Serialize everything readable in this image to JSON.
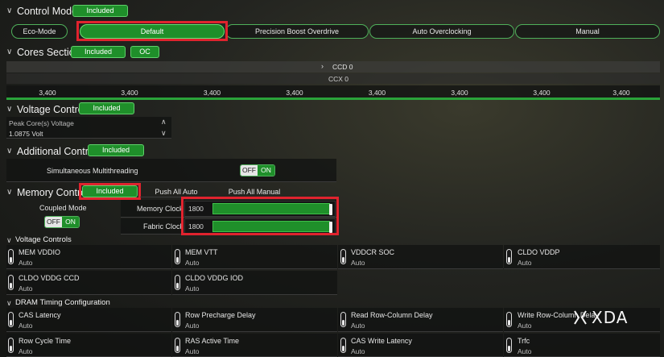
{
  "control_mode": {
    "title": "Control Mode",
    "badge": "Included",
    "eco_mode": "Eco-Mode",
    "tabs": [
      "Default",
      "Precision Boost Overdrive",
      "Auto Overclocking",
      "Manual"
    ]
  },
  "cores_section": {
    "title": "Cores Section",
    "badge": "Included",
    "oc": "OC",
    "ccd": "CCD 0",
    "ccx": "CCX 0",
    "frequencies": [
      "3,400",
      "3,400",
      "3,400",
      "3,400",
      "3,400",
      "3,400",
      "3,400",
      "3,400"
    ]
  },
  "voltage_control": {
    "title": "Voltage Control",
    "badge": "Included",
    "label": "Peak Core(s) Voltage",
    "value": "1.0875 Volt"
  },
  "additional_control": {
    "title": "Additional Control",
    "badge": "Included",
    "smt_label": "Simultaneous Multithreading",
    "off": "OFF",
    "on": "ON"
  },
  "memory_control": {
    "title": "Memory Control",
    "badge": "Included",
    "push_all_auto": "Push All Auto",
    "push_all_manual": "Push All Manual",
    "coupled_mode": "Coupled Mode",
    "off": "OFF",
    "on": "ON",
    "memory_clock_label": "Memory Clock",
    "memory_clock_value": "1800",
    "fabric_clock_label": "Fabric Clock",
    "fabric_clock_value": "1800"
  },
  "voltage_controls": {
    "title": "Voltage Controls",
    "items": [
      {
        "name": "MEM VDDIO",
        "value": "Auto"
      },
      {
        "name": "MEM VTT",
        "value": "Auto"
      },
      {
        "name": "VDDCR SOC",
        "value": "Auto"
      },
      {
        "name": "CLDO VDDP",
        "value": "Auto"
      },
      {
        "name": "CLDO VDDG CCD",
        "value": "Auto"
      },
      {
        "name": "CLDO VDDG IOD",
        "value": "Auto"
      }
    ]
  },
  "dram_timing": {
    "title": "DRAM Timing Configuration",
    "items": [
      {
        "name": "CAS Latency",
        "value": "Auto"
      },
      {
        "name": "Row Precharge Delay",
        "value": "Auto"
      },
      {
        "name": "Read Row-Column Delay",
        "value": "Auto"
      },
      {
        "name": "Write Row-Column Delay",
        "value": "Auto"
      },
      {
        "name": "Row Cycle Time",
        "value": "Auto"
      },
      {
        "name": "RAS Active Time",
        "value": "Auto"
      },
      {
        "name": "CAS Write Latency",
        "value": "Auto"
      },
      {
        "name": "Trfc",
        "value": "Auto"
      }
    ]
  },
  "watermark": "XDA"
}
